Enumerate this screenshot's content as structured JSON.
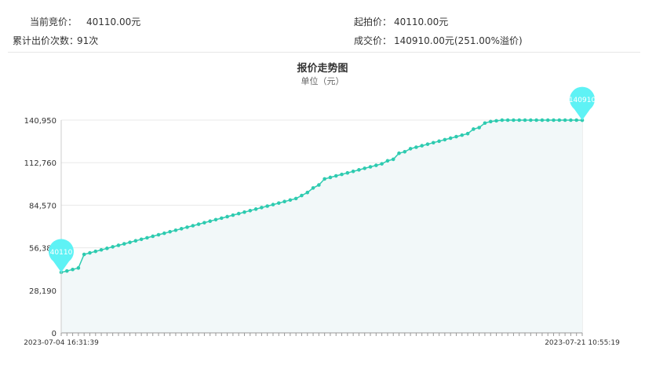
{
  "info": {
    "current_bid_label": "当前竞价：",
    "current_bid_value": "40110.00元",
    "bid_count_label": "累计出价次数：",
    "bid_count_value": "91次",
    "start_price_label": "起拍价：",
    "start_price_value": "40110.00元",
    "deal_price_label": "成交价：",
    "deal_price_value": "140910.00元(251.00%溢价)"
  },
  "colors": {
    "line": "#2ecbb0",
    "marker": "#5ef2f5",
    "area": "#f2f8f9",
    "grid": "#e8e8e8"
  },
  "chart_data": {
    "type": "area",
    "title": "报价走势图",
    "subtitle": "单位（元）",
    "y_ticks": [
      "0",
      "28,190",
      "56,380",
      "84,570",
      "112,760",
      "140,950"
    ],
    "ylim": [
      0,
      140950
    ],
    "x_labels": [
      "2023-07-04 16:31:39",
      "2023-07-21 10:55:19"
    ],
    "grid": true,
    "markers": [
      {
        "index": 0,
        "label": "40110"
      },
      {
        "index": 91,
        "label": "140910"
      }
    ],
    "values": [
      40110,
      41000,
      42000,
      43000,
      52000,
      53000,
      54000,
      55000,
      56000,
      57000,
      58000,
      59000,
      60000,
      61000,
      62000,
      63000,
      64000,
      65000,
      66000,
      67000,
      68000,
      69000,
      70000,
      71000,
      72000,
      73000,
      74000,
      75000,
      76000,
      77000,
      78000,
      79000,
      80000,
      81000,
      82000,
      83000,
      84000,
      85000,
      86000,
      87000,
      88000,
      89000,
      91000,
      93000,
      96000,
      98000,
      102000,
      103000,
      104000,
      105000,
      106000,
      107000,
      108000,
      109000,
      110000,
      111000,
      112000,
      114000,
      115000,
      119000,
      120000,
      122000,
      123000,
      124000,
      125000,
      126000,
      127000,
      128000,
      129000,
      130000,
      131000,
      132000,
      135000,
      136000,
      139000,
      140000,
      140500,
      141500,
      142500,
      143500,
      144500,
      145500,
      146500,
      147500,
      148500,
      149500,
      150500,
      151500,
      152500,
      153500,
      154500,
      140910
    ]
  }
}
